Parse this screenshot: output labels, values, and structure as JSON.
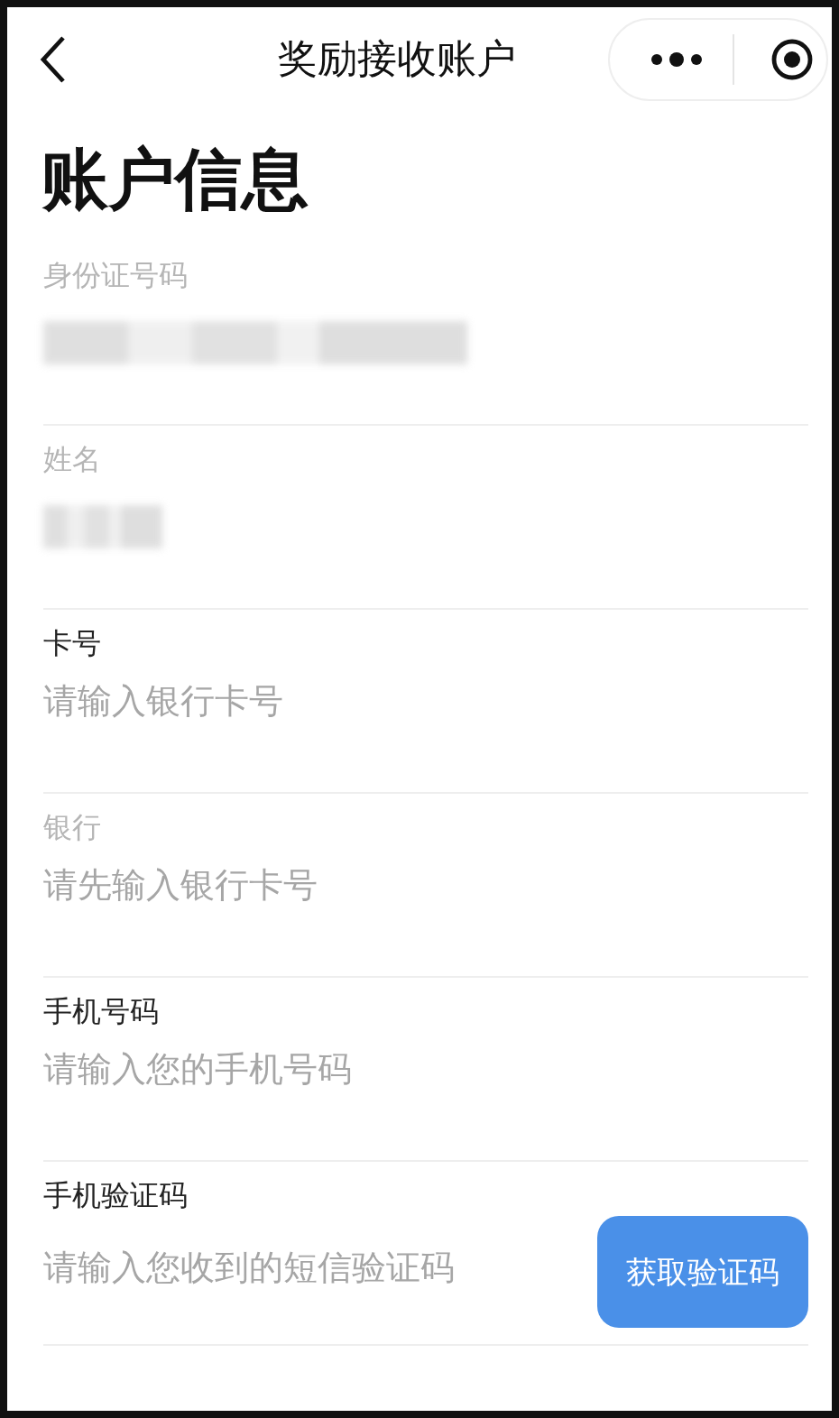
{
  "nav": {
    "title": "奖励接收账户"
  },
  "heading": "账户信息",
  "fields": [
    {
      "label": "身份证号码",
      "disabled": true,
      "kind": "redacted"
    },
    {
      "label": "姓名",
      "disabled": true,
      "kind": "redacted"
    },
    {
      "label": "卡号",
      "disabled": false,
      "kind": "input",
      "placeholder": "请输入银行卡号"
    },
    {
      "label": "银行",
      "disabled": true,
      "kind": "input",
      "placeholder": "请先输入银行卡号"
    },
    {
      "label": "手机号码",
      "disabled": false,
      "kind": "input",
      "placeholder": "请输入您的手机号码"
    },
    {
      "label": "手机验证码",
      "disabled": false,
      "kind": "input",
      "placeholder": "请输入您收到的短信验证码",
      "button": "获取验证码"
    }
  ]
}
